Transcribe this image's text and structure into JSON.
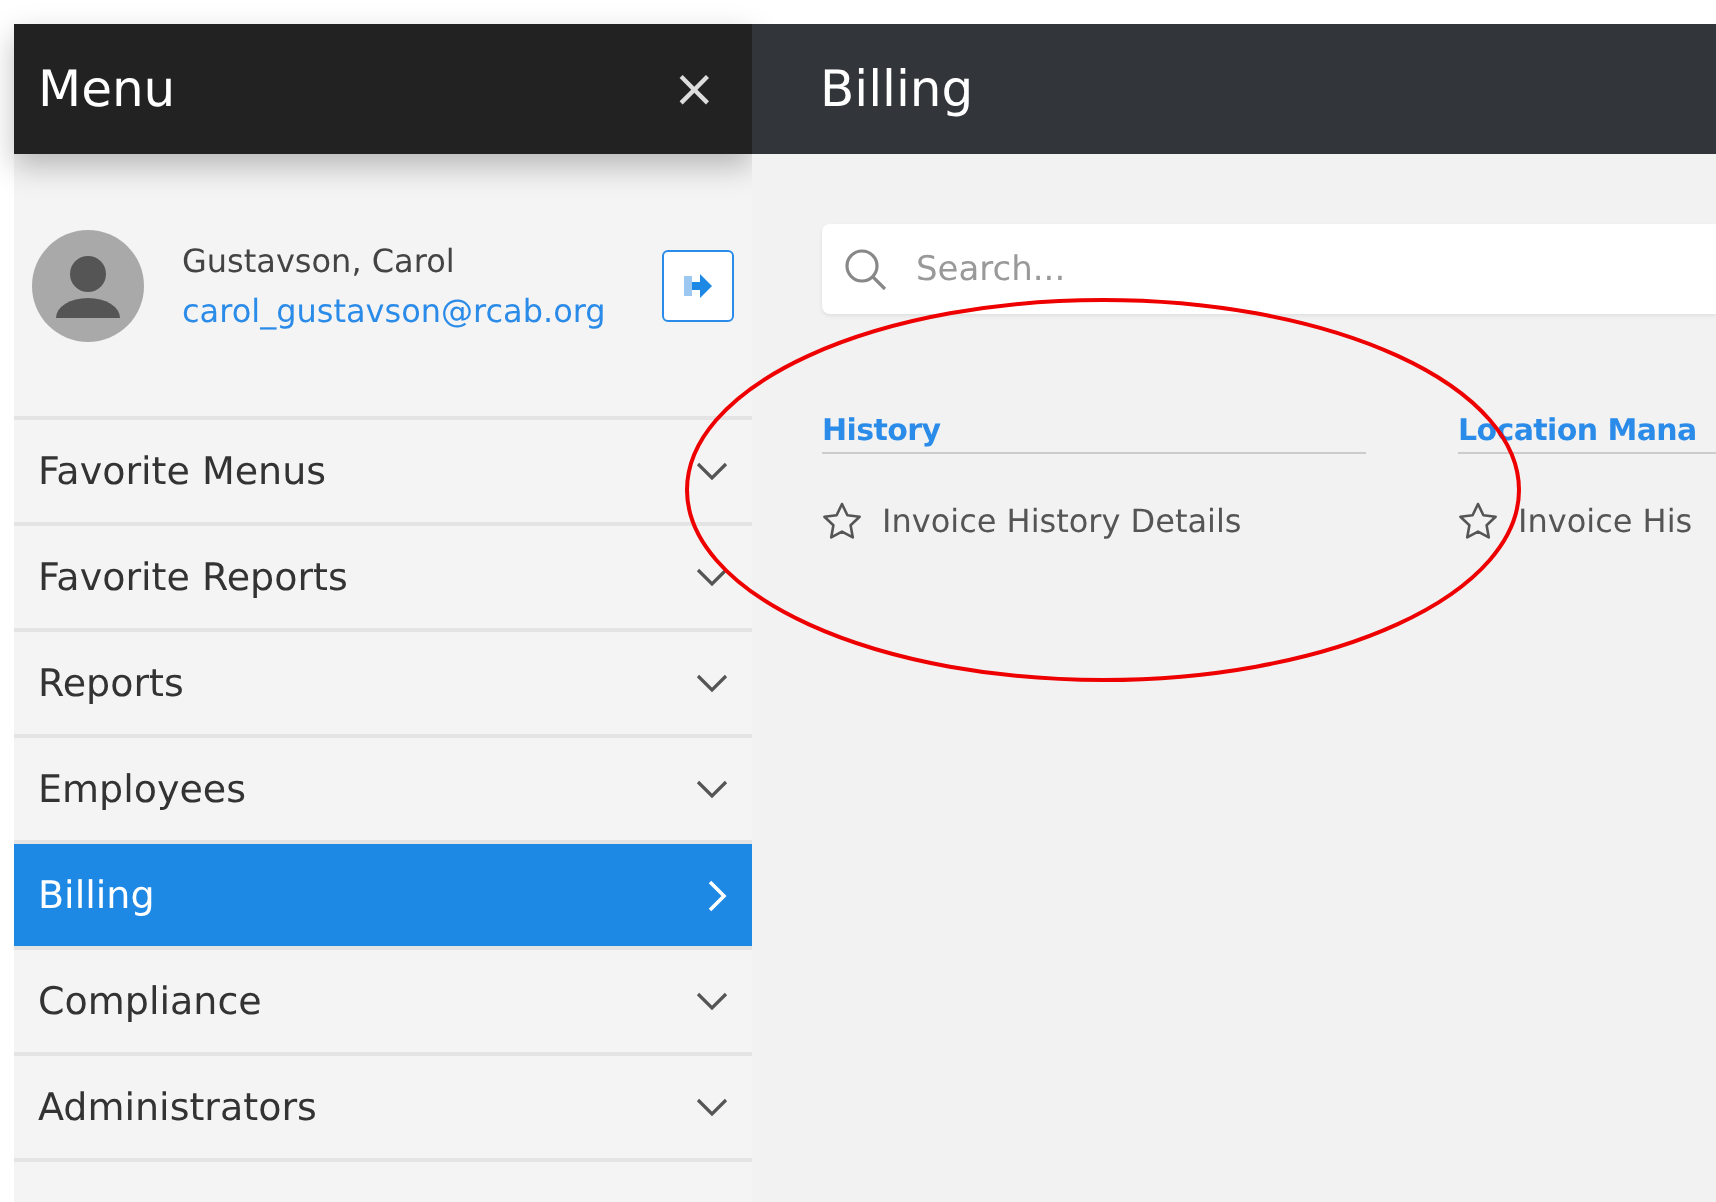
{
  "menu": {
    "title": "Menu",
    "close": "×"
  },
  "user": {
    "name": "Gustavson, Carol",
    "email": "carol_gustavson@rcab.org"
  },
  "nav": [
    {
      "label": "Favorite Menus",
      "selected": false
    },
    {
      "label": "Favorite Reports",
      "selected": false
    },
    {
      "label": "Reports",
      "selected": false
    },
    {
      "label": "Employees",
      "selected": false
    },
    {
      "label": "Billing",
      "selected": true
    },
    {
      "label": "Compliance",
      "selected": false
    },
    {
      "label": "Administrators",
      "selected": false
    }
  ],
  "page": {
    "title": "Billing"
  },
  "search": {
    "placeholder": "Search..."
  },
  "sections": [
    {
      "heading": "History",
      "items": [
        "Invoice History Details"
      ]
    },
    {
      "heading": "Location Mana",
      "items": [
        "Invoice His"
      ]
    }
  ]
}
